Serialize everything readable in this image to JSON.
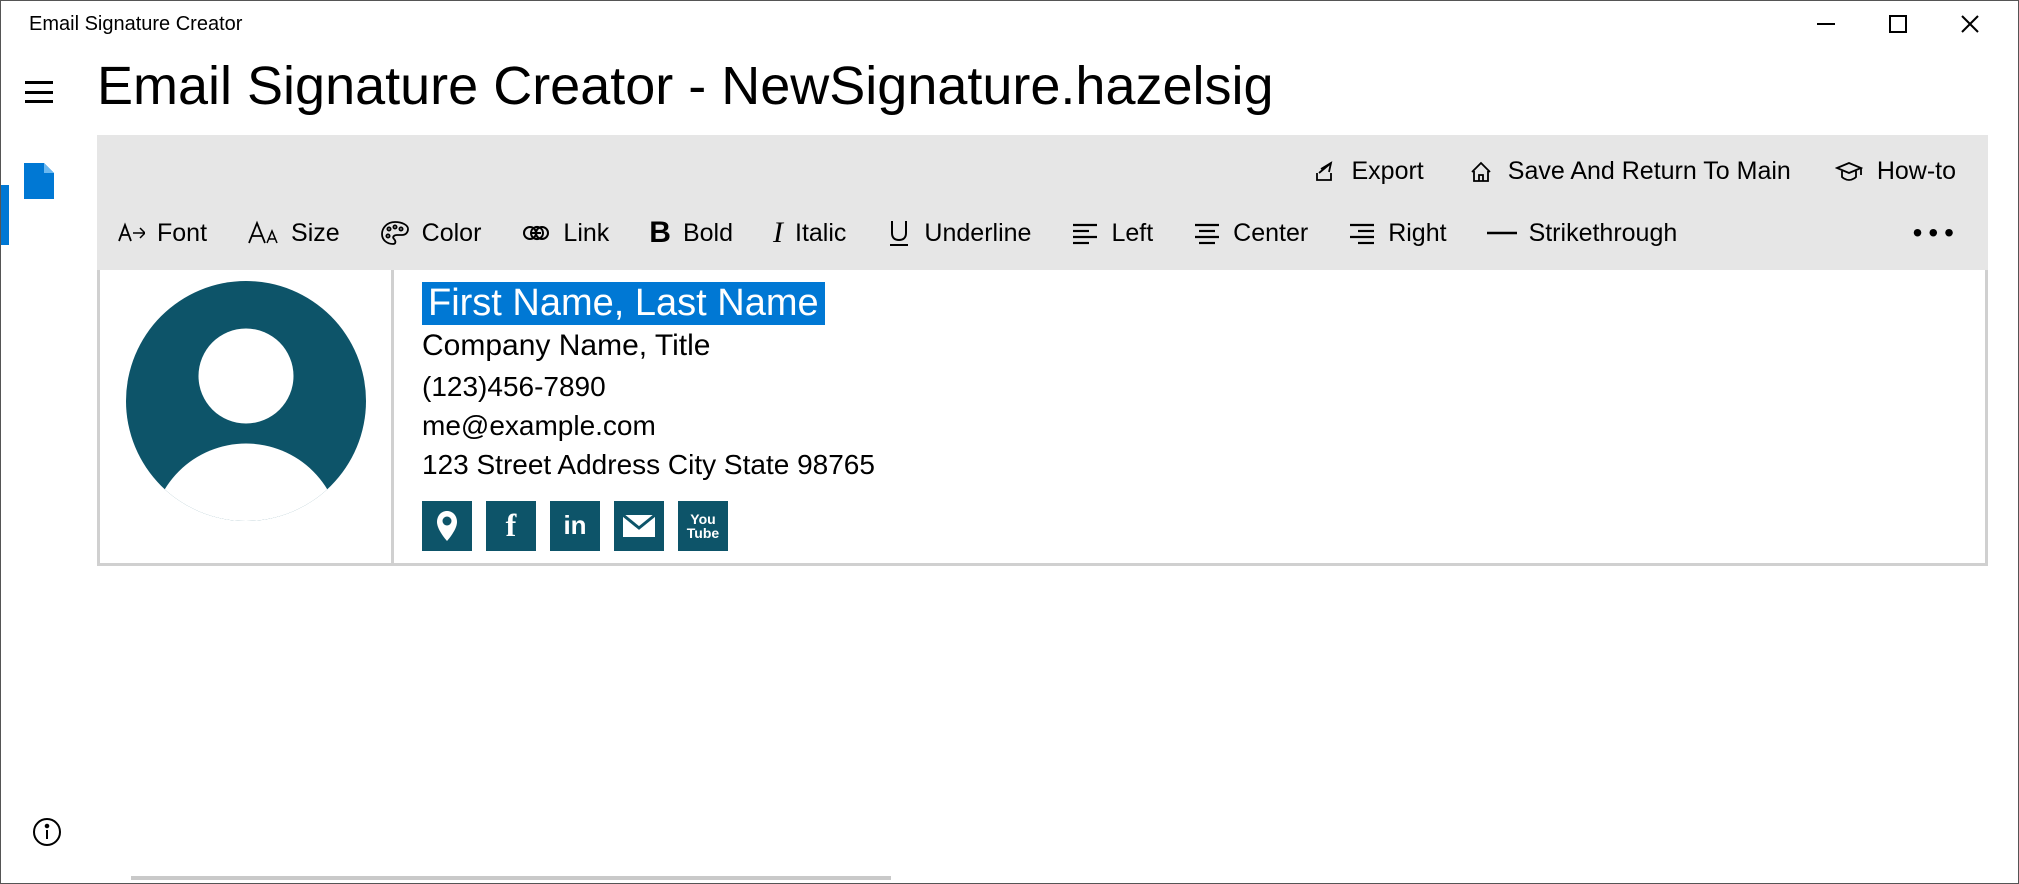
{
  "window": {
    "title": "Email Signature Creator"
  },
  "page": {
    "title": "Email Signature Creator - NewSignature.hazelsig"
  },
  "ribbon": {
    "top": {
      "export": "Export",
      "save": "Save And Return To Main",
      "howto": "How-to"
    },
    "tools": {
      "font": "Font",
      "size": "Size",
      "color": "Color",
      "link": "Link",
      "bold": "Bold",
      "italic": "Italic",
      "underline": "Underline",
      "left": "Left",
      "center": "Center",
      "right": "Right",
      "strike": "Strikethrough"
    }
  },
  "signature": {
    "name": "First Name, Last Name",
    "company": "Company Name, Title",
    "phone": "(123)456-7890",
    "email": "me@example.com",
    "address": "123 Street Address City State 98765"
  },
  "social": {
    "location": "location",
    "facebook": "f",
    "linkedin": "in",
    "mail": "mail",
    "youtube_l1": "You",
    "youtube_l2": "Tube"
  }
}
